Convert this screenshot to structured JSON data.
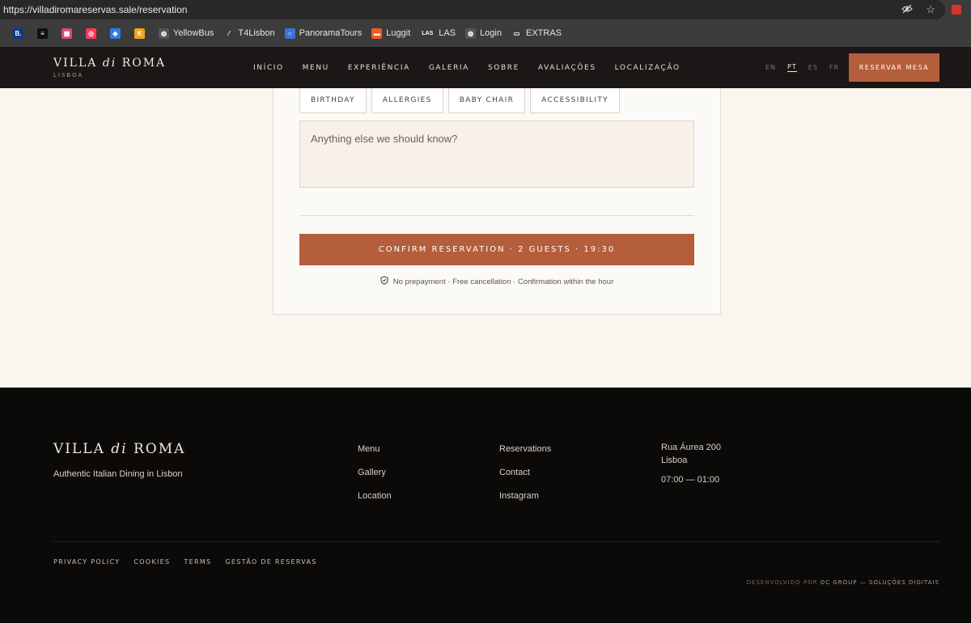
{
  "browser": {
    "url": "https://villadiromareservas.sale/reservation",
    "bookmarks": [
      {
        "label": "",
        "icon": "booking-icon",
        "color": "#0a3a8c",
        "glyph": "B."
      },
      {
        "label": "",
        "icon": "document-icon",
        "color": "#111111",
        "glyph": "≡"
      },
      {
        "label": "",
        "icon": "app-icon",
        "color": "#d44a7a",
        "glyph": "▦"
      },
      {
        "label": "",
        "icon": "airbnb-icon",
        "color": "#ff385c",
        "glyph": "◎"
      },
      {
        "label": "",
        "icon": "cube-icon",
        "color": "#2f7de1",
        "glyph": "◆"
      },
      {
        "label": "",
        "icon": "tools-icon",
        "color": "#f2a31b",
        "glyph": "K"
      },
      {
        "label": "YellowBus",
        "icon": "globe-icon",
        "color": "#555555",
        "glyph": "◍"
      },
      {
        "label": "T4Lisbon",
        "icon": "pen-icon",
        "color": "#3c3c3c",
        "glyph": "⁄"
      },
      {
        "label": "PanoramaTours",
        "icon": "circle-icon",
        "color": "#3b73d9",
        "glyph": "○"
      },
      {
        "label": "Luggit",
        "icon": "luggit-icon",
        "color": "#f05a22",
        "glyph": "▬"
      },
      {
        "label": "LAS",
        "icon": "las-icon",
        "color": "#3c3c3c",
        "glyph": "LAS"
      },
      {
        "label": "Login",
        "icon": "globe-icon",
        "color": "#555555",
        "glyph": "◍"
      },
      {
        "label": "EXTRAS",
        "icon": "folder-icon",
        "color": "#3c3c3c",
        "glyph": "▭"
      }
    ]
  },
  "header": {
    "logo_pre": "VILLA ",
    "logo_di": "di",
    "logo_post": " ROMA",
    "city": "LISBOA",
    "nav": [
      "INÍCIO",
      "MENU",
      "EXPERIÊNCIA",
      "GALERIA",
      "SOBRE",
      "AVALIAÇÕES",
      "LOCALIZAÇÃO"
    ],
    "langs": [
      "EN",
      "PT",
      "ES",
      "FR"
    ],
    "active_lang": "PT",
    "reserve_label": "RESERVAR MESA"
  },
  "form": {
    "occasions": [
      "BIRTHDAY",
      "ALLERGIES",
      "BABY CHAIR",
      "ACCESSIBILITY"
    ],
    "notes_placeholder": "Anything else we should know?",
    "confirm_label": "CONFIRM RESERVATION · 2 GUESTS · 19:30",
    "assurance": "No prepayment · Free cancellation · Confirmation within the hour"
  },
  "footer": {
    "logo_pre": "VILLA ",
    "logo_di": "di",
    "logo_post": " ROMA",
    "tagline": "Authentic Italian Dining in Lisbon",
    "col1": [
      "Menu",
      "Gallery",
      "Location"
    ],
    "col2": [
      "Reservations",
      "Contact",
      "Instagram"
    ],
    "address_line1": "Rua Áurea 200",
    "address_line2": "Lisboa",
    "hours": "07:00 — 01:00",
    "legal": [
      "PRIVACY POLICY",
      "COOKIES",
      "TERMS",
      "GESTÃO DE RESERVAS"
    ],
    "credit_pre": "DESENVOLVIDO POR ",
    "credit_company": "OC GROUP — SOLUÇÕES DIGITAIS"
  },
  "colors": {
    "accent": "#b45e3c",
    "header_bg": "#1b1716",
    "footer_bg": "#0c0a09",
    "page_bg": "#faf5ee"
  }
}
